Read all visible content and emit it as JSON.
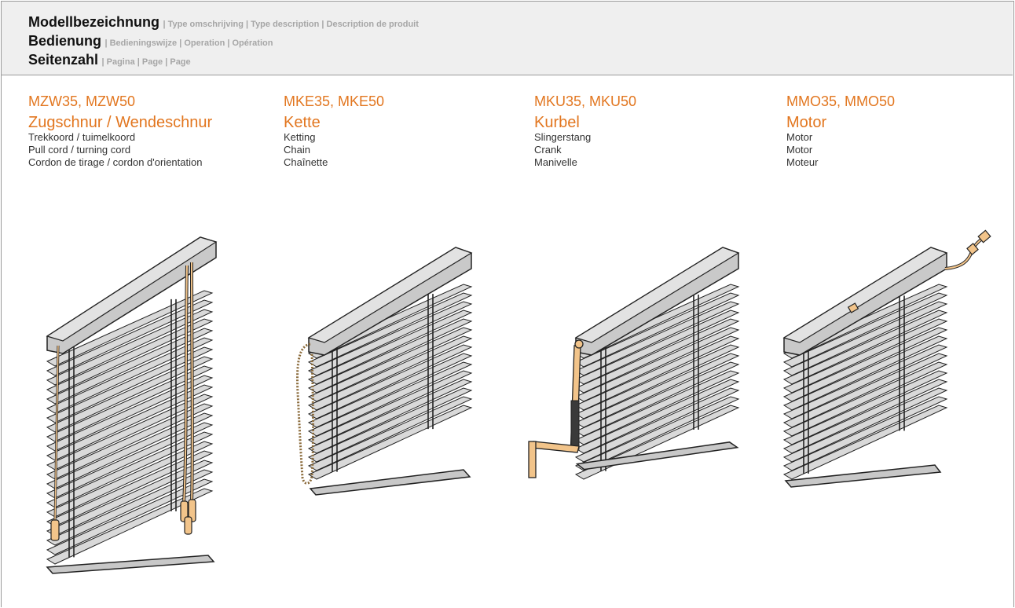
{
  "header": {
    "line1": {
      "bold": "Modellbezeichnung",
      "light": "| Type omschrijving | Type description | Description de produit"
    },
    "line2": {
      "bold": "Bedienung",
      "light": "| Bedieningswijze | Operation | Opération"
    },
    "line3": {
      "bold": "Seitenzahl",
      "light": "| Pagina | Page | Page"
    }
  },
  "columns": [
    {
      "model": "MZW35, MZW50",
      "mode": "Zugschnur / Wendeschnur",
      "lines": [
        "Trekkoord / tuimelkoord",
        "Pull cord / turning cord",
        "Cordon de tirage / cordon d'orientation"
      ]
    },
    {
      "model": "MKE35, MKE50",
      "mode": "Kette",
      "lines": [
        "Ketting",
        "Chain",
        "Chaînette"
      ]
    },
    {
      "model": "MKU35, MKU50",
      "mode": "Kurbel",
      "lines": [
        "Slingerstang",
        "Crank",
        "Manivelle"
      ]
    },
    {
      "model": "MMO35, MMO50",
      "mode": "Motor",
      "lines": [
        "Motor",
        "Motor",
        "Moteur"
      ]
    }
  ],
  "colors": {
    "accent": "#e2761f",
    "operator": "#f2c48a",
    "slat": "#d9d9d9",
    "outline": "#222222"
  },
  "illustrations": [
    "venetian-blind-pull-cord",
    "venetian-blind-chain",
    "venetian-blind-crank",
    "venetian-blind-motor"
  ]
}
